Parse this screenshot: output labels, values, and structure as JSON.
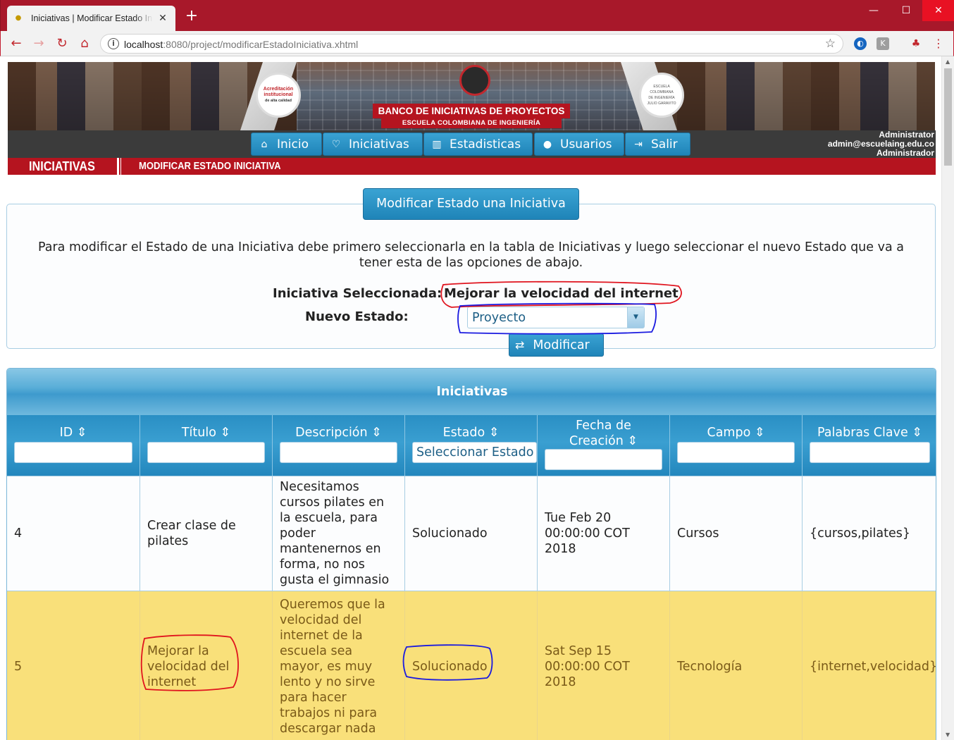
{
  "browser": {
    "tab_title": "Iniciativas | Modificar Estado Iniciativa",
    "new_tab": "+",
    "url_host": "localhost",
    "url_rest": ":8080/project/modificarEstadoIniciativa.xhtml"
  },
  "banner": {
    "seal_left_line1": "Acreditación",
    "seal_left_line2": "institucional",
    "seal_left_line3": "de alta calidad",
    "seal_right_line1": "ESCUELA",
    "seal_right_line2": "COLOMBIANA",
    "seal_right_line3": "DE INGENIERÍA",
    "seal_right_line4": "JULIO GARAVITO",
    "title": "BANCO DE INICIATIVAS DE PROYECTOS",
    "subtitle": "ESCUELA COLOMBIANA DE INGENIERÍA"
  },
  "menu": {
    "items": [
      {
        "label": "Inicio",
        "icon": "home-icon"
      },
      {
        "label": "Iniciativas",
        "icon": "lightbulb-icon"
      },
      {
        "label": "Estadisticas",
        "icon": "bar-chart-icon"
      },
      {
        "label": "Usuarios",
        "icon": "user-icon"
      },
      {
        "label": "Salir",
        "icon": "sign-out-icon"
      }
    ],
    "user_name": "Administrator",
    "user_email": "admin@escuelaing.edu.co",
    "user_role": "Administrador"
  },
  "breadcrumb": {
    "section": "INICIATIVAS",
    "page": "MODIFICAR ESTADO INICIATIVA"
  },
  "form": {
    "legend": "Modificar Estado una Iniciativa",
    "instructions": "Para modificar el Estado de una Iniciativa debe primero seleccionarla en la tabla de Iniciativas y luego seleccionar el nuevo Estado que va a tener esta de las opciones de abajo.",
    "selected_label": "Iniciativa Seleccionada:",
    "selected_value": "Mejorar la velocidad del internet",
    "estado_label": "Nuevo Estado:",
    "estado_value": "Proyecto",
    "submit_label": "Modificar"
  },
  "table": {
    "caption": "Iniciativas",
    "columns": [
      {
        "label": "ID ⇕"
      },
      {
        "label": "Título ⇕"
      },
      {
        "label": "Descripción ⇕"
      },
      {
        "label": "Estado ⇕"
      },
      {
        "label": "Fecha de Creación ⇕"
      },
      {
        "label": "Campo ⇕"
      },
      {
        "label": "Palabras Clave ⇕"
      }
    ],
    "estado_filter": "Seleccionar Estado",
    "rows": [
      {
        "id": "4",
        "titulo": "Crear clase de pilates",
        "descripcion": "Necesitamos cursos pilates en la escuela, para poder mantenernos en forma, no nos gusta el gimnasio",
        "estado": "Solucionado",
        "fecha": "Tue Feb 20 00:00:00 COT 2018",
        "campo": "Cursos",
        "palabras": "{cursos,pilates}"
      },
      {
        "id": "5",
        "titulo": "Mejorar la velocidad del internet",
        "descripcion": "Queremos que la velocidad del internet de la escuela sea mayor, es muy lento y no sirve para hacer trabajos ni para descargar nada",
        "estado": "Solucionado",
        "fecha": "Sat Sep 15 00:00:00 COT 2018",
        "campo": "Tecnología",
        "palabras": "{internet,velocidad}"
      }
    ]
  },
  "colors": {
    "chrome_red": "#a8182a",
    "primary_blue": "#1f84b8",
    "brand_red": "#b5141f",
    "selected_row": "#f9e07a",
    "annotation_red": "#e0141e",
    "annotation_blue": "#1a1ae0"
  }
}
